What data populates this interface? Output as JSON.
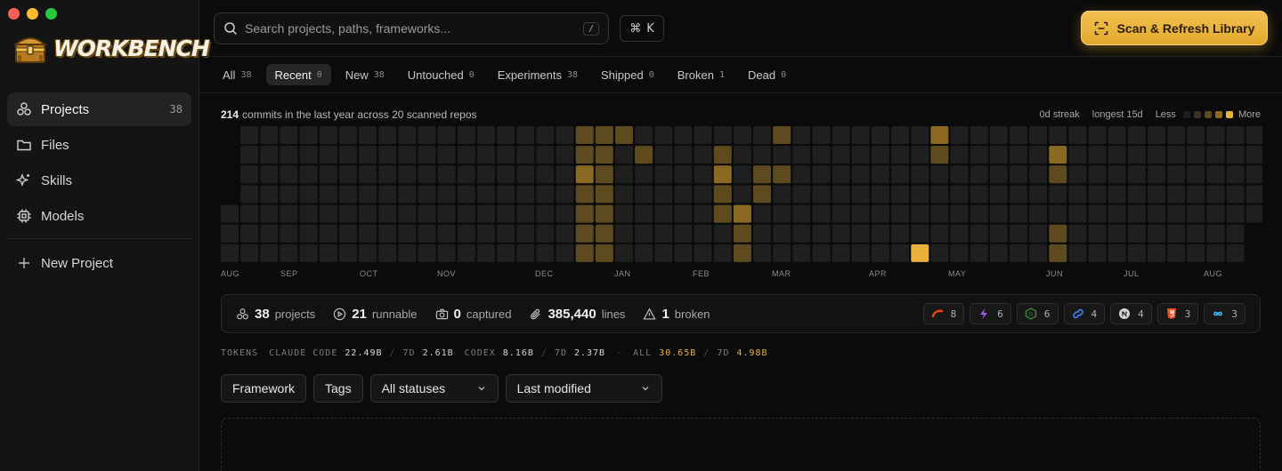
{
  "window": {
    "controls": [
      "close",
      "minimize",
      "zoom"
    ]
  },
  "brand": {
    "name": "WORKBENCH"
  },
  "sidebar": {
    "items": [
      {
        "label": "Projects",
        "icon": "projects-icon",
        "count": "38",
        "active": true
      },
      {
        "label": "Files",
        "icon": "folder-icon",
        "count": ""
      },
      {
        "label": "Skills",
        "icon": "sparkle-icon",
        "count": ""
      },
      {
        "label": "Models",
        "icon": "chip-icon",
        "count": ""
      }
    ],
    "new_project": "New Project"
  },
  "search": {
    "placeholder": "Search projects, paths, frameworks...",
    "shortcut": "/"
  },
  "command": {
    "key": "⌘",
    "letter": "K"
  },
  "scan_button": {
    "label": "Scan & Refresh Library"
  },
  "tabs": [
    {
      "label": "All",
      "count": "38"
    },
    {
      "label": "Recent",
      "count": "0",
      "active": true
    },
    {
      "label": "New",
      "count": "38"
    },
    {
      "label": "Untouched",
      "count": "0"
    },
    {
      "label": "Experiments",
      "count": "38"
    },
    {
      "label": "Shipped",
      "count": "0"
    },
    {
      "label": "Broken",
      "count": "1"
    },
    {
      "label": "Dead",
      "count": "0"
    }
  ],
  "activity": {
    "commits": "214",
    "summary": "commits in the last year across 20 scanned repos",
    "streak": "0d streak",
    "longest": "longest 15d",
    "less": "Less",
    "more": "More",
    "months": [
      "AUG",
      "SEP",
      "OCT",
      "NOV",
      "DEC",
      "JAN",
      "FEB",
      "MAR",
      "APR",
      "MAY",
      "JUN",
      "JUL",
      "AUG"
    ],
    "levels_colors": [
      "#1f1f1f",
      "#3a3120",
      "#5e4a1f",
      "#8a6a22",
      "#e8b13c"
    ],
    "cells": [
      {
        "week": 18,
        "day": 0,
        "level": 2
      },
      {
        "week": 18,
        "day": 1,
        "level": 2
      },
      {
        "week": 18,
        "day": 2,
        "level": 3
      },
      {
        "week": 18,
        "day": 3,
        "level": 2
      },
      {
        "week": 18,
        "day": 4,
        "level": 2
      },
      {
        "week": 18,
        "day": 5,
        "level": 2
      },
      {
        "week": 18,
        "day": 6,
        "level": 2
      },
      {
        "week": 19,
        "day": 0,
        "level": 2
      },
      {
        "week": 19,
        "day": 1,
        "level": 2
      },
      {
        "week": 19,
        "day": 2,
        "level": 2
      },
      {
        "week": 19,
        "day": 3,
        "level": 2
      },
      {
        "week": 19,
        "day": 4,
        "level": 2
      },
      {
        "week": 19,
        "day": 5,
        "level": 2
      },
      {
        "week": 19,
        "day": 6,
        "level": 2
      },
      {
        "week": 20,
        "day": 0,
        "level": 2
      },
      {
        "week": 21,
        "day": 1,
        "level": 2
      },
      {
        "week": 25,
        "day": 1,
        "level": 2
      },
      {
        "week": 25,
        "day": 2,
        "level": 3
      },
      {
        "week": 25,
        "day": 3,
        "level": 2
      },
      {
        "week": 25,
        "day": 4,
        "level": 2
      },
      {
        "week": 26,
        "day": 4,
        "level": 3
      },
      {
        "week": 26,
        "day": 5,
        "level": 2
      },
      {
        "week": 26,
        "day": 6,
        "level": 2
      },
      {
        "week": 27,
        "day": 2,
        "level": 2
      },
      {
        "week": 27,
        "day": 3,
        "level": 2
      },
      {
        "week": 28,
        "day": 0,
        "level": 2
      },
      {
        "week": 28,
        "day": 2,
        "level": 2
      },
      {
        "week": 35,
        "day": 6,
        "level": 4
      },
      {
        "week": 36,
        "day": 0,
        "level": 3
      },
      {
        "week": 36,
        "day": 1,
        "level": 2
      },
      {
        "week": 42,
        "day": 1,
        "level": 3
      },
      {
        "week": 42,
        "day": 2,
        "level": 2
      },
      {
        "week": 42,
        "day": 5,
        "level": 2
      },
      {
        "week": 42,
        "day": 6,
        "level": 2
      }
    ]
  },
  "stats": [
    {
      "icon": "projects-icon",
      "value": "38",
      "label": "projects"
    },
    {
      "icon": "play-circle-icon",
      "value": "21",
      "label": "runnable"
    },
    {
      "icon": "camera-icon",
      "value": "0",
      "label": "captured"
    },
    {
      "icon": "paperclip-icon",
      "value": "385,440",
      "label": "lines"
    },
    {
      "icon": "warning-icon",
      "value": "1",
      "label": "broken"
    }
  ],
  "frameworks": [
    {
      "icon": "svelte-icon",
      "count": "8",
      "color": "#ff3e00"
    },
    {
      "icon": "bolt-icon",
      "count": "6",
      "color": "#a855f7"
    },
    {
      "icon": "node-icon",
      "count": "6",
      "color": "#3c873a"
    },
    {
      "icon": "link-icon",
      "count": "4",
      "color": "#3b82f6"
    },
    {
      "icon": "nextjs-icon",
      "count": "4",
      "color": "#d4d4d4"
    },
    {
      "icon": "html5-icon",
      "count": "3",
      "color": "#e34f26"
    },
    {
      "icon": "infinity-icon",
      "count": "3",
      "color": "#38bdf8"
    }
  ],
  "tokens": {
    "label": "TOKENS",
    "claude_label": "CLAUDE CODE",
    "claude_total": "22.49B",
    "claude_7d_label": "7D",
    "claude_7d": "2.61B",
    "codex_label": "CODEX",
    "codex_total": "8.16B",
    "codex_7d_label": "7D",
    "codex_7d": "2.37B",
    "all_label": "ALL",
    "all_total": "30.65B",
    "all_7d_label": "7D",
    "all_7d": "4.98B"
  },
  "filters": {
    "framework": "Framework",
    "tags": "Tags",
    "status": "All statuses",
    "sort": "Last modified"
  }
}
